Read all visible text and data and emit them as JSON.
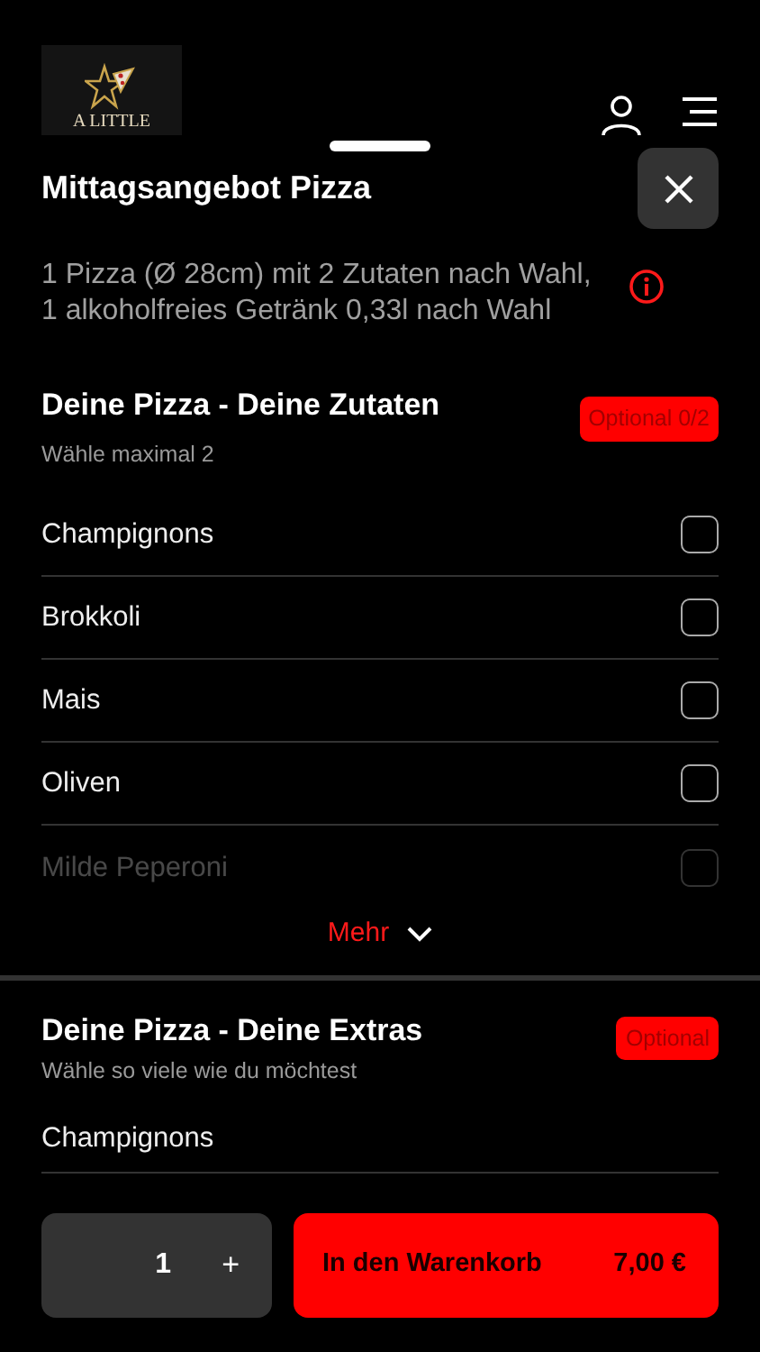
{
  "header": {
    "logo_text": "A LITTLE"
  },
  "sheet": {
    "title": "Mittagsangebot Pizza",
    "description": "1 Pizza (Ø 28cm) mit 2 Zutaten nach Wahl, 1 alkoholfreies Getränk 0,33l nach Wahl"
  },
  "groups": [
    {
      "title": "Deine Pizza - Deine Zutaten",
      "subtitle": "Wähle maximal 2",
      "badge": "Optional 0/2",
      "more": "Mehr",
      "options": [
        {
          "label": "Champignons",
          "checked": false,
          "faded": false
        },
        {
          "label": "Brokkoli",
          "checked": false,
          "faded": false
        },
        {
          "label": "Mais",
          "checked": false,
          "faded": false
        },
        {
          "label": "Oliven",
          "checked": false,
          "faded": false
        },
        {
          "label": "Milde Peperoni",
          "checked": false,
          "faded": true
        }
      ]
    },
    {
      "title": "Deine Pizza - Deine Extras",
      "subtitle": "Wähle so viele wie du möchtest",
      "badge": "Optional",
      "options": [
        {
          "label": "Champignons",
          "faded": false
        }
      ]
    }
  ],
  "footer": {
    "quantity": "1",
    "plus": "+",
    "cart_label": "In den Warenkorb",
    "price": "7,00 €"
  }
}
